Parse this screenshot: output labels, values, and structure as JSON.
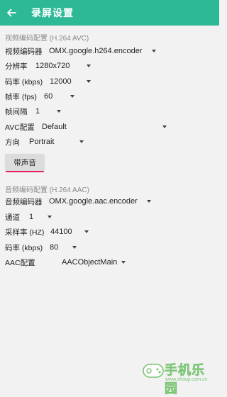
{
  "header": {
    "title": "录屏设置",
    "back_icon": "arrow-left-icon",
    "color": "#2db896"
  },
  "video_section": {
    "title": "视频编码配置 (H.264 AVC)",
    "encoder": {
      "label": "视频编码器",
      "value": "OMX.google.h264.encoder"
    },
    "resolution": {
      "label": "分辨率",
      "value": "1280x720"
    },
    "bitrate": {
      "label": "码率 (kbps)",
      "value": "12000"
    },
    "framerate": {
      "label": "帧率 (fps)",
      "value": "60"
    },
    "iframe_interval": {
      "label": "帧间隔",
      "value": "1"
    },
    "avc_profile": {
      "label": "AVC配置",
      "value": "Default"
    },
    "orientation": {
      "label": "方向",
      "value": "Portrait"
    }
  },
  "audio_toggle": {
    "label": "带声音",
    "underline_color": "#e91e63"
  },
  "audio_section": {
    "title": "音频编码配置 (H.264 AAC)",
    "encoder": {
      "label": "音频编码器",
      "value": "OMX.google.aac.encoder"
    },
    "channels": {
      "label": "通道",
      "value": "1"
    },
    "samplerate": {
      "label": "采样率 (HZ)",
      "value": "44100"
    },
    "bitrate": {
      "label": "码率 (kbps)",
      "value": "80"
    },
    "aac_profile": {
      "label": "AAC配置",
      "value": "AACObjectMain"
    }
  },
  "watermark": {
    "text": "手机乐园",
    "url": "www.shouji.com.cn",
    "color": "#7cc576"
  }
}
